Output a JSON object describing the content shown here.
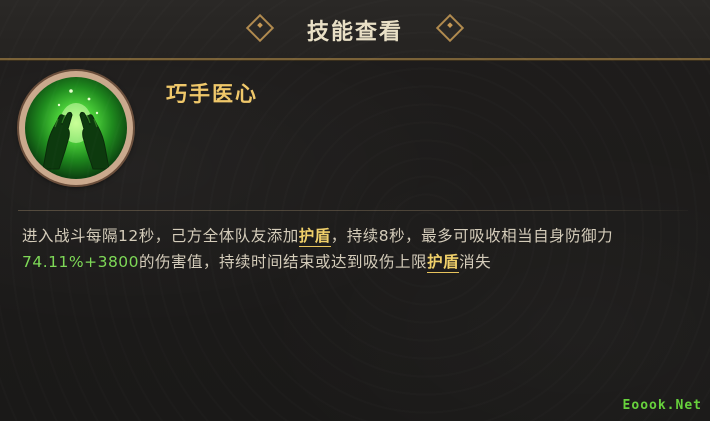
{
  "header": {
    "title": "技能查看"
  },
  "skill": {
    "name": "巧手医心",
    "icon": "healing-hands-icon",
    "description": {
      "p1": "进入战斗每隔12秒，己方全体队友添加",
      "kw1": "护盾",
      "p2": "，持续8秒，最多可吸收相当自身防御力",
      "value": "74.11%+3800",
      "p3": "的伤害值，持续时间结束或达到吸伤上限",
      "kw2": "护盾",
      "p4": "消失"
    }
  },
  "watermark": "Eoook.Net",
  "colors": {
    "accent_gold": "#f0c86a",
    "value_green": "#7ed957",
    "text": "#d4ccba"
  }
}
